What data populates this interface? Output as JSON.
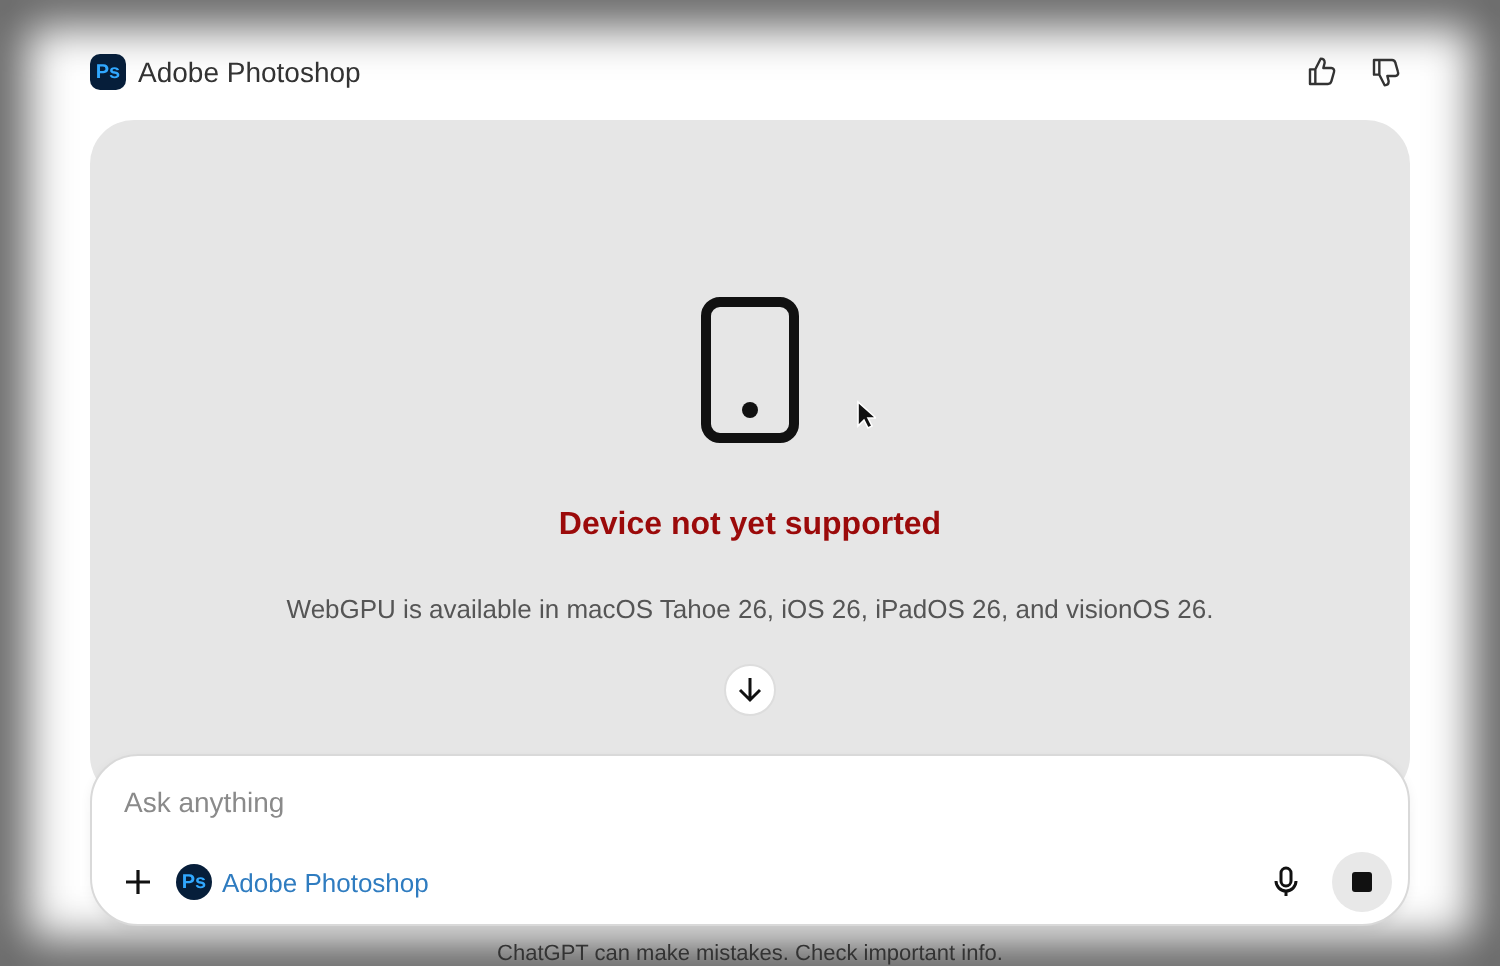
{
  "header": {
    "app_logo": "Ps",
    "app_name": "Adobe Photoshop"
  },
  "panel": {
    "title": "Device not yet supported",
    "message": "WebGPU is available in macOS Tahoe 26, iOS 26, iPadOS 26, and visionOS 26."
  },
  "composer": {
    "placeholder": "Ask anything",
    "tool_logo": "Ps",
    "tool_name": "Adobe Photoshop"
  },
  "footer": "ChatGPT can make mistakes. Check important info."
}
